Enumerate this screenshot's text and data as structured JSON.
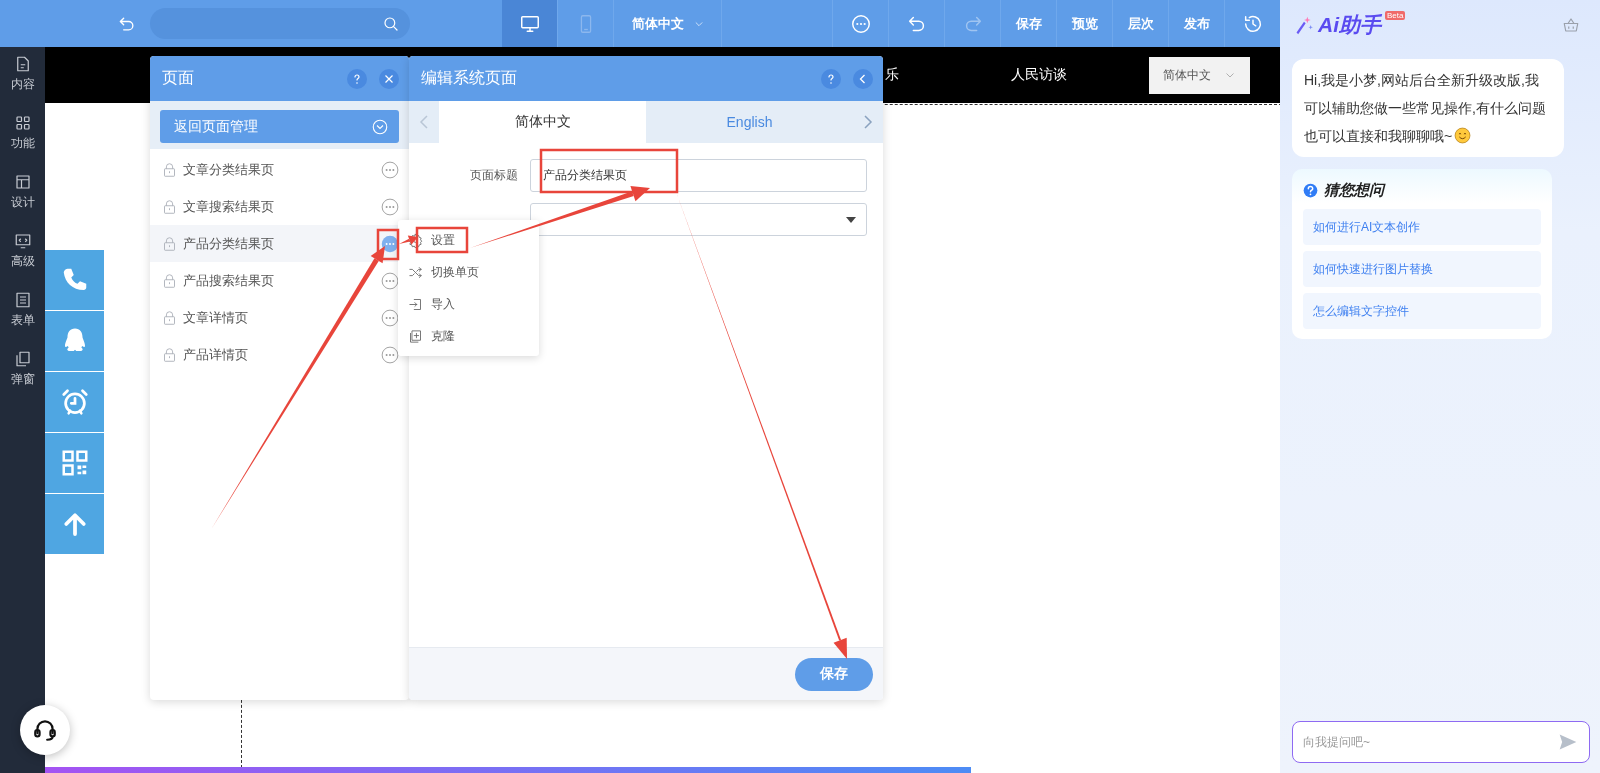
{
  "toolbar": {
    "devices": [
      {
        "kind": "desktop",
        "selected": true
      },
      {
        "kind": "mobile",
        "selected": false
      }
    ],
    "language": "简体中文",
    "actions": [
      {
        "kind": "more",
        "disabled": false
      },
      {
        "kind": "undo",
        "disabled": false
      },
      {
        "kind": "redo",
        "disabled": true
      },
      {
        "kind": "text",
        "label": "保存",
        "disabled": false
      },
      {
        "kind": "text",
        "label": "预览",
        "disabled": false
      },
      {
        "kind": "text",
        "label": "层次",
        "disabled": false
      },
      {
        "kind": "text",
        "label": "发布",
        "disabled": false
      },
      {
        "kind": "history",
        "disabled": false
      }
    ]
  },
  "sidebar": {
    "items": [
      {
        "kind": "content",
        "label": "内容"
      },
      {
        "kind": "function",
        "label": "功能"
      },
      {
        "kind": "design",
        "label": "设计"
      },
      {
        "kind": "advanced",
        "label": "高级"
      },
      {
        "kind": "form",
        "label": "表单"
      },
      {
        "kind": "popup",
        "label": "弹窗"
      }
    ]
  },
  "site_header": {
    "nav": [
      "乐",
      "人民访谈"
    ],
    "language": "简体中文"
  },
  "loading_bar": {
    "level": 0.75
  },
  "float_buttons": [
    {
      "kind": "phone"
    },
    {
      "kind": "qq"
    },
    {
      "kind": "alarm"
    },
    {
      "kind": "qrcode"
    },
    {
      "kind": "top"
    }
  ],
  "pages_panel": {
    "title": "页面",
    "back_button": "返回页面管理",
    "pages": [
      {
        "label": "文章分类结果页",
        "selected": false
      },
      {
        "label": "文章搜索结果页",
        "selected": false
      },
      {
        "label": "产品分类结果页",
        "selected": true
      },
      {
        "label": "产品搜索结果页",
        "selected": false
      },
      {
        "label": "文章详情页",
        "selected": false
      },
      {
        "label": "产品详情页",
        "selected": false
      }
    ]
  },
  "context_menu": {
    "items": [
      {
        "kind": "settings",
        "label": "设置"
      },
      {
        "kind": "switch",
        "label": "切换单页"
      },
      {
        "kind": "import",
        "label": "导入"
      },
      {
        "kind": "clone",
        "label": "克隆"
      }
    ]
  },
  "edit_panel": {
    "title": "编辑系统页面",
    "tabs": [
      {
        "label": "简体中文",
        "selected": true
      },
      {
        "label": "English",
        "selected": false
      }
    ],
    "fields": [
      {
        "kind": "text",
        "label": "页面标题",
        "value": "产品分类结果页"
      },
      {
        "kind": "select"
      }
    ],
    "save_button": "保存"
  },
  "assistant": {
    "title": "Ai助手",
    "badge": "Beta",
    "greeting": "Hi,我是小梦,网站后台全新升级改版,我可以辅助您做一些常见操作,有什么问题也可以直接和我聊聊哦~",
    "suggest_title": "猜您想问",
    "suggestions": [
      "如何进行AI文本创作",
      "如何快速进行图片替换",
      "怎么编辑文字控件"
    ],
    "input": {
      "placeholder": "向我提问吧~"
    }
  }
}
